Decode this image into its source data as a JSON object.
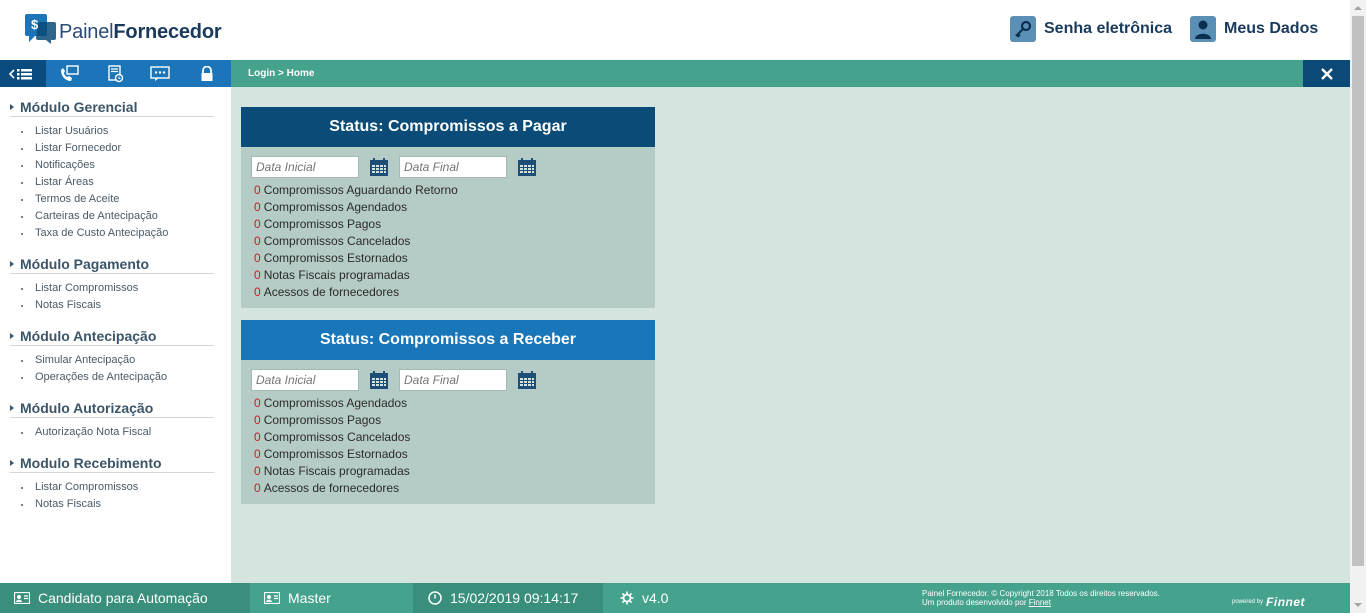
{
  "header": {
    "logo_part1": "Painel",
    "logo_part2": "Fornecedor",
    "logo_symbol": "$",
    "links": [
      {
        "label": "Senha eletrônica",
        "icon": "key-icon"
      },
      {
        "label": "Meus Dados",
        "icon": "user-icon"
      }
    ]
  },
  "nav": {
    "icons": [
      "list-menu-icon",
      "phone-icon",
      "document-icon",
      "chat-icon",
      "lock-icon"
    ],
    "breadcrumb": "Login > Home",
    "close_icon": "close-icon"
  },
  "sidebar": {
    "modules": [
      {
        "title": "Módulo Gerencial",
        "items": [
          "Listar Usuários",
          "Listar Fornecedor",
          "Notificações",
          "Listar Áreas",
          "Termos de Aceite",
          "Carteiras de Antecipação",
          "Taxa de Custo Antecipação"
        ]
      },
      {
        "title": "Módulo Pagamento",
        "items": [
          "Listar Compromissos",
          "Notas Fiscais"
        ]
      },
      {
        "title": "Módulo Antecipação",
        "items": [
          "Simular Antecipação",
          "Operações de Antecipação"
        ]
      },
      {
        "title": "Módulo Autorização",
        "items": [
          "Autorização Nota Fiscal"
        ]
      },
      {
        "title": "Modulo Recebimento",
        "items": [
          "Listar Compromissos",
          "Notas Fiscais"
        ]
      }
    ]
  },
  "cards": [
    {
      "title": "Status: Compromissos a Pagar",
      "header_color": "#0a4b77",
      "date_start_placeholder": "Data Inicial",
      "date_end_placeholder": "Data Final",
      "stats": [
        {
          "value": "0",
          "label": "Compromissos Aguardando Retorno"
        },
        {
          "value": "0",
          "label": "Compromissos Agendados"
        },
        {
          "value": "0",
          "label": "Compromissos Pagos"
        },
        {
          "value": "0",
          "label": "Compromissos Cancelados"
        },
        {
          "value": "0",
          "label": "Compromissos Estornados"
        },
        {
          "value": "0",
          "label": "Notas Fiscais programadas"
        },
        {
          "value": "0",
          "label": "Acessos de fornecedores"
        }
      ]
    },
    {
      "title": "Status: Compromissos a Receber",
      "header_color": "#1976b9",
      "date_start_placeholder": "Data Inicial",
      "date_end_placeholder": "Data Final",
      "stats": [
        {
          "value": "0",
          "label": "Compromissos Agendados"
        },
        {
          "value": "0",
          "label": "Compromissos Pagos"
        },
        {
          "value": "0",
          "label": "Compromissos Cancelados"
        },
        {
          "value": "0",
          "label": "Compromissos Estornados"
        },
        {
          "value": "0",
          "label": "Notas Fiscais programadas"
        },
        {
          "value": "0",
          "label": "Acessos de fornecedores"
        }
      ]
    }
  ],
  "footer": {
    "user": "Candidato para Automação",
    "role": "Master",
    "datetime": "15/02/2019 09:14:17",
    "version": "v4.0",
    "copyright_line1": "Painel Fornecedor. © Copyright 2018 Todos os direitos reservados.",
    "copyright_line2_prefix": "Um produto desenvolvido por ",
    "copyright_link": "Finnet",
    "powered_by": "powered by",
    "brand": "Finnet"
  },
  "colors": {
    "teal": "#44a28d",
    "dark_blue": "#0a4b77",
    "blue": "#1976b9",
    "counter_red": "#c41f1f"
  }
}
